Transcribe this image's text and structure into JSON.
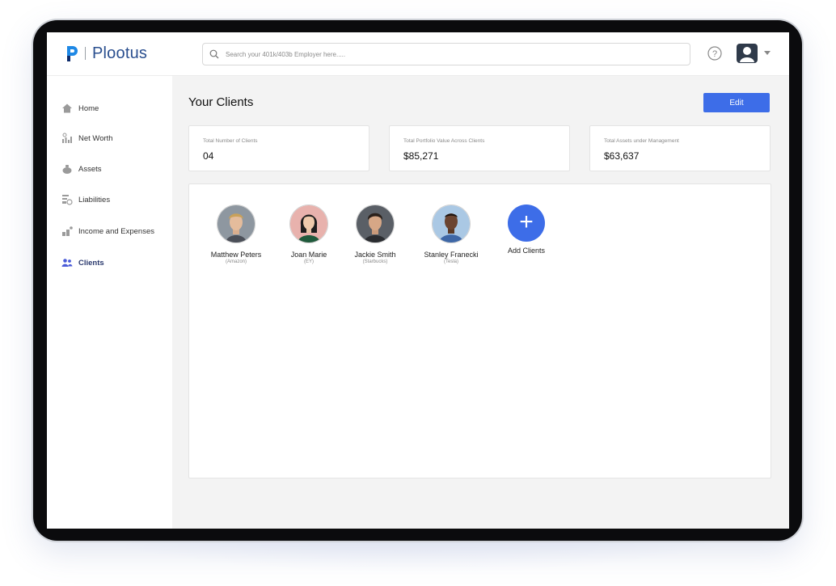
{
  "app": {
    "name": "Plootus"
  },
  "search": {
    "placeholder": "Search your 401k/403b Employer here....."
  },
  "sidebar": {
    "items": [
      {
        "label": "Home",
        "icon": "home-icon"
      },
      {
        "label": "Net Worth",
        "icon": "net-worth-icon"
      },
      {
        "label": "Assets",
        "icon": "assets-icon"
      },
      {
        "label": "Liabilities",
        "icon": "liabilities-icon"
      },
      {
        "label": "Income and Expenses",
        "icon": "income-expenses-icon"
      },
      {
        "label": "Clients",
        "icon": "clients-icon"
      }
    ],
    "active": "Clients"
  },
  "main": {
    "title": "Your Clients",
    "edit_label": "Edit",
    "stats": [
      {
        "label": "Total Number of Clients",
        "value": "04"
      },
      {
        "label": "Total Portfolio Value Across Clients",
        "value": "$85,271"
      },
      {
        "label": "Total Assets under Management",
        "value": "$63,637"
      }
    ],
    "clients": [
      {
        "name": "Matthew Peters",
        "company": "(Amazon)"
      },
      {
        "name": "Joan Marie",
        "company": "(EY)"
      },
      {
        "name": "Jackie Smith",
        "company": "(Starbucks)"
      },
      {
        "name": "Stanley Franecki",
        "company": "(Tesla)"
      }
    ],
    "add_label": "Add Clients"
  },
  "colors": {
    "accent": "#3d6de8",
    "brand": "#2a4f8f"
  }
}
